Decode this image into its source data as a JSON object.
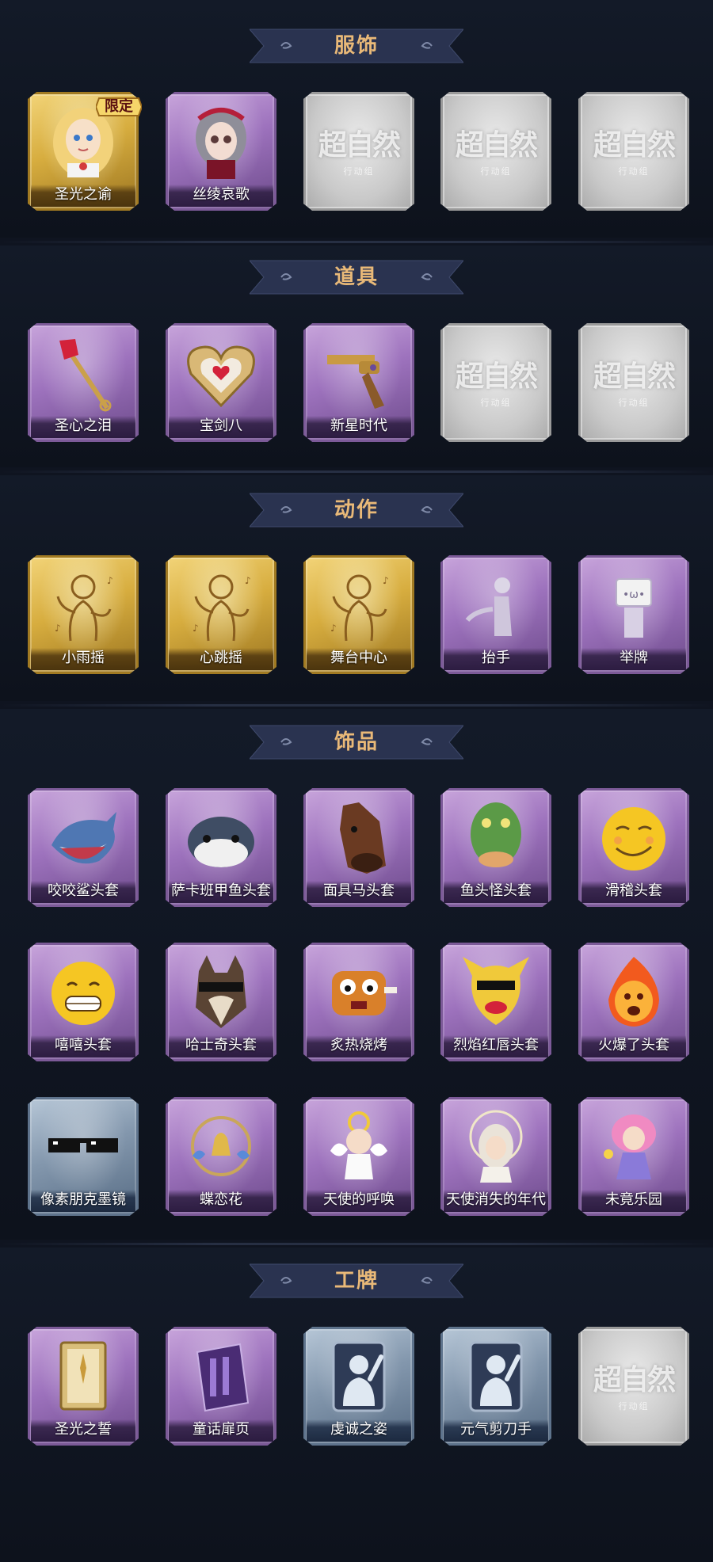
{
  "sections": [
    {
      "title": "服饰",
      "items": [
        {
          "label": "圣光之谕",
          "style": "gold",
          "icon": "angel-portrait-icon",
          "badge": "限定"
        },
        {
          "label": "丝绫哀歌",
          "style": "purple",
          "icon": "gothic-doll-portrait-icon"
        },
        {
          "style": "gray",
          "placeholder": "超自然",
          "placeholder_sub": "行动组"
        },
        {
          "style": "gray",
          "placeholder": "超自然",
          "placeholder_sub": "行动组"
        },
        {
          "style": "gray",
          "placeholder": "超自然",
          "placeholder_sub": "行动组"
        }
      ]
    },
    {
      "title": "道具",
      "items": [
        {
          "label": "圣心之泪",
          "style": "purple",
          "icon": "ruby-scepter-icon"
        },
        {
          "label": "宝剑八",
          "style": "purple",
          "icon": "heart-shield-icon"
        },
        {
          "label": "新星时代",
          "style": "purple",
          "icon": "revolver-icon"
        },
        {
          "style": "gray",
          "placeholder": "超自然",
          "placeholder_sub": "行动组"
        },
        {
          "style": "gray",
          "placeholder": "超自然",
          "placeholder_sub": "行动组"
        }
      ]
    },
    {
      "title": "动作",
      "items": [
        {
          "label": "小雨摇",
          "style": "gold",
          "icon": "dance-pose-icon"
        },
        {
          "label": "心跳摇",
          "style": "gold",
          "icon": "dance-pose-icon"
        },
        {
          "label": "舞台中心",
          "style": "gold",
          "icon": "dance-pose-icon"
        },
        {
          "label": "抬手",
          "style": "purple",
          "icon": "raise-hand-pose-icon"
        },
        {
          "label": "举牌",
          "style": "purple",
          "icon": "hold-sign-pose-icon"
        }
      ]
    },
    {
      "title": "饰品",
      "items": [
        {
          "label": "咬咬鲨头套",
          "style": "purple",
          "icon": "shark-head-icon"
        },
        {
          "label": "萨卡班甲鱼头套",
          "style": "purple",
          "icon": "fish-head-icon"
        },
        {
          "label": "面具马头套",
          "style": "purple",
          "icon": "horse-head-icon"
        },
        {
          "label": "鱼头怪头套",
          "style": "purple",
          "icon": "fish-monster-head-icon"
        },
        {
          "label": "滑稽头套",
          "style": "purple",
          "icon": "funny-face-head-icon"
        },
        {
          "label": "嘻嘻头套",
          "style": "purple",
          "icon": "grin-face-head-icon"
        },
        {
          "label": "哈士奇头套",
          "style": "purple",
          "icon": "husky-head-icon"
        },
        {
          "label": "炙热烧烤",
          "style": "purple",
          "icon": "bbq-head-icon"
        },
        {
          "label": "烈焰红唇头套",
          "style": "purple",
          "icon": "yellow-lips-head-icon"
        },
        {
          "label": "火爆了头套",
          "style": "purple",
          "icon": "fire-head-icon"
        },
        {
          "label": "像素朋克墨镜",
          "style": "blue",
          "icon": "pixel-sunglasses-icon"
        },
        {
          "label": "蝶恋花",
          "style": "purple",
          "icon": "butterfly-bell-icon"
        },
        {
          "label": "天使的呼唤",
          "style": "purple",
          "icon": "angel-doll-icon"
        },
        {
          "label": "天使消失的年代",
          "style": "purple",
          "icon": "halo-girl-icon"
        },
        {
          "label": "未竟乐园",
          "style": "purple",
          "icon": "fairy-doll-icon"
        }
      ]
    },
    {
      "title": "工牌",
      "items": [
        {
          "label": "圣光之誓",
          "style": "purple",
          "icon": "golden-card-icon"
        },
        {
          "label": "童话扉页",
          "style": "purple",
          "icon": "purple-book-icon"
        },
        {
          "label": "虔诚之姿",
          "style": "blue",
          "icon": "silhouette-card-icon"
        },
        {
          "label": "元气剪刀手",
          "style": "blue",
          "icon": "silhouette-card-icon"
        },
        {
          "style": "gray",
          "placeholder": "超自然",
          "placeholder_sub": "行动组"
        }
      ]
    }
  ]
}
